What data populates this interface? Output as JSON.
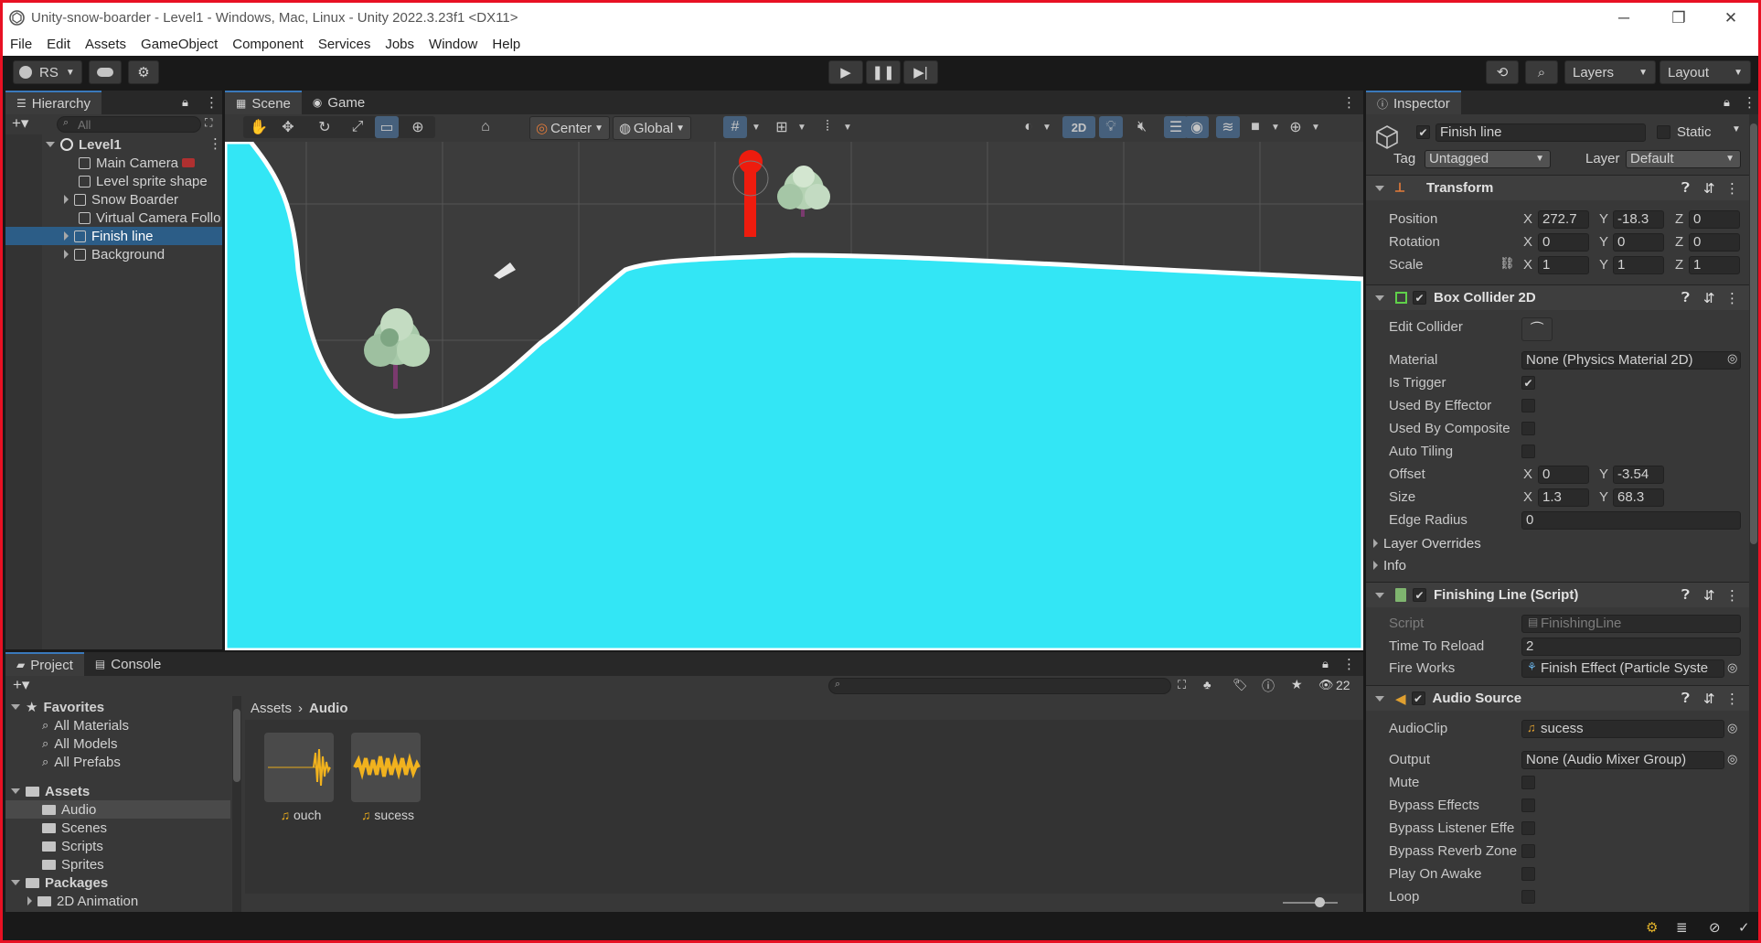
{
  "window": {
    "title": "Unity-snow-boarder - Level1 - Windows, Mac, Linux - Unity 2022.3.23f1 <DX11>",
    "minimize": "─",
    "restore": "❐",
    "close": "✕"
  },
  "menu": [
    "File",
    "Edit",
    "Assets",
    "GameObject",
    "Component",
    "Services",
    "Jobs",
    "Window",
    "Help"
  ],
  "toolbar": {
    "account": "RS",
    "layers": "Layers",
    "layout": "Layout"
  },
  "hierarchy": {
    "tab": "Hierarchy",
    "search_placeholder": "All",
    "scene": "Level1",
    "items": [
      {
        "label": "Main Camera",
        "has_children": false,
        "selected": false
      },
      {
        "label": "Level sprite shape",
        "has_children": false,
        "selected": false
      },
      {
        "label": "Snow Boarder",
        "has_children": true,
        "selected": false
      },
      {
        "label": "Virtual Camera Follo",
        "has_children": false,
        "selected": false
      },
      {
        "label": "Finish line",
        "has_children": true,
        "selected": true
      },
      {
        "label": "Background",
        "has_children": true,
        "selected": false
      }
    ]
  },
  "scene": {
    "tab_scene": "Scene",
    "tab_game": "Game",
    "pivot": "Center",
    "space": "Global",
    "mode_2d": "2D",
    "sky_color": "#3c3c3c",
    "snow_color": "#33e6f5",
    "grid_color": "#555555"
  },
  "inspector": {
    "tab": "Inspector",
    "object_name": "Finish line",
    "static_label": "Static",
    "tag_label": "Tag",
    "tag_value": "Untagged",
    "layer_label": "Layer",
    "layer_value": "Default",
    "transform": {
      "title": "Transform",
      "position_label": "Position",
      "rotation_label": "Rotation",
      "scale_label": "Scale",
      "position": [
        "272.7",
        "-18.3",
        "0"
      ],
      "rotation": [
        "0",
        "0",
        "0"
      ],
      "scale": [
        "1",
        "1",
        "1"
      ]
    },
    "box_collider": {
      "title": "Box Collider 2D",
      "edit_collider": "Edit Collider",
      "material_label": "Material",
      "material_value": "None (Physics Material 2D)",
      "is_trigger_label": "Is Trigger",
      "is_trigger": true,
      "used_by_effector_label": "Used By Effector",
      "used_by_composite_label": "Used By Composite",
      "auto_tiling_label": "Auto Tiling",
      "offset_label": "Offset",
      "offset": [
        "0",
        "-3.54"
      ],
      "size_label": "Size",
      "size": [
        "1.3",
        "68.3"
      ],
      "edge_radius_label": "Edge Radius",
      "edge_radius": "0",
      "layer_overrides": "Layer Overrides",
      "info": "Info"
    },
    "script": {
      "title": "Finishing Line (Script)",
      "script_label": "Script",
      "script_value": "FinishingLine",
      "time_to_reload_label": "Time To Reload",
      "time_to_reload": "2",
      "fireworks_label": "Fire Works",
      "fireworks_value": "Finish Effect (Particle Syste"
    },
    "audio": {
      "title": "Audio Source",
      "clip_label": "AudioClip",
      "clip_value": "sucess",
      "output_label": "Output",
      "output_value": "None (Audio Mixer Group)",
      "mute_label": "Mute",
      "bypass_effects_label": "Bypass Effects",
      "bypass_listener_label": "Bypass Listener Effe",
      "bypass_reverb_label": "Bypass Reverb Zone",
      "play_on_awake_label": "Play On Awake",
      "loop_label": "Loop"
    }
  },
  "project": {
    "tab_project": "Project",
    "tab_console": "Console",
    "hidden_count": "22",
    "favorites": "Favorites",
    "fav_items": [
      "All Materials",
      "All Models",
      "All Prefabs"
    ],
    "assets": "Assets",
    "asset_folders": [
      "Audio",
      "Scenes",
      "Scripts",
      "Sprites"
    ],
    "packages": "Packages",
    "package_items": [
      "2D Animation"
    ],
    "breadcrumb_root": "Assets",
    "breadcrumb_sep": "›",
    "breadcrumb_current": "Audio",
    "files": [
      "ouch",
      "sucess"
    ]
  }
}
